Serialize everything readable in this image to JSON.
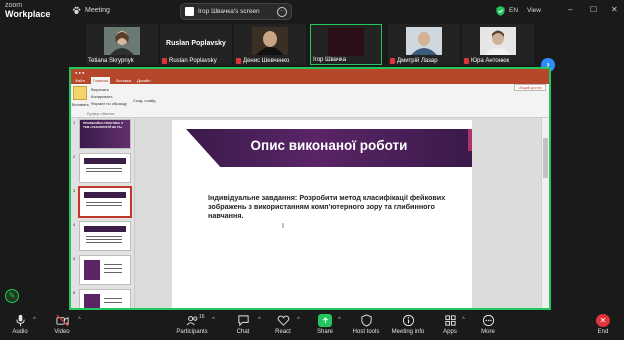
{
  "app": {
    "logo_line1": "zoom",
    "logo_line2": "Workplace",
    "meeting_label": "Meeting"
  },
  "share_indicator": {
    "label": "Ігор Швачка's screen"
  },
  "topbar_right": {
    "lang": "EN",
    "view": "View"
  },
  "participants_strip": {
    "tiles": [
      {
        "name": "Tetiana Skrypnyk"
      },
      {
        "name": "Ruslan Poplavsky",
        "display": "Ruslan Poplavsky"
      },
      {
        "name": "Денис Шевченко"
      },
      {
        "name": "Ігор Швачка"
      },
      {
        "name": "Дмитрій Лазар"
      },
      {
        "name": "Юра Антонюк"
      }
    ]
  },
  "ppt": {
    "tabs": [
      "Файл",
      "Главная",
      "Вставка",
      "Дизайн"
    ],
    "ribbon_items": [
      "Вставить",
      "Вырезать",
      "Копировать",
      "Формат по образцу",
      "Буфер обмена",
      "Созд. слайд"
    ],
    "share_button": "Общий доступ",
    "thumb_numbers": [
      "1",
      "2",
      "3",
      "4",
      "5",
      "6"
    ],
    "thumb1_text": "ПРОФЕСІЙНА ПРАКТИКА З ТЕМ «ТЕХНОЛОГІЙ ШІ ТА»",
    "slide": {
      "title": "Опис виконаної роботи",
      "body": "Індивідуальне завдання: Розробити метод класифікації фейкових зображень з використанням комп'ютерного зору та глибинного навчання.",
      "cursor": "I"
    }
  },
  "toolbar": {
    "audio": "Audio",
    "video": "Video",
    "participants": "Participants",
    "participants_count": "15",
    "chat": "Chat",
    "react": "React",
    "share": "Share",
    "host_tools": "Host tools",
    "meeting_info": "Meeting info",
    "apps": "Apps",
    "more": "More",
    "end": "End"
  }
}
